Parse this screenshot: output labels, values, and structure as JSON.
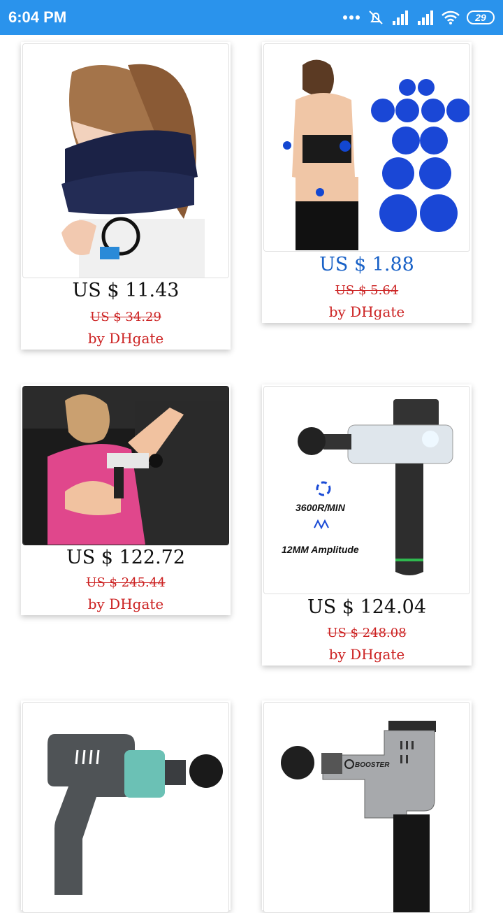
{
  "status": {
    "time": "6:04 PM",
    "battery": "29"
  },
  "products": [
    {
      "price": "US $ 11.43",
      "old_price": "US $ 34.29",
      "seller": "by DHgate"
    },
    {
      "price": "US $ 1.88",
      "old_price": "US $ 5.64",
      "seller": "by DHgate"
    },
    {
      "price": "US $ 122.72",
      "old_price": "US $ 245.44",
      "seller": "by DHgate"
    },
    {
      "price": "US $ 124.04",
      "old_price": "US $ 248.08",
      "seller": "by DHgate",
      "image_text": [
        "3600R/MIN",
        "12MM Amplitude"
      ]
    },
    {
      "image_text": []
    },
    {
      "image_text": [
        "BOOSTER"
      ]
    }
  ],
  "colors": {
    "status_bar": "#2a93ec",
    "strike_red": "#cc2222",
    "link_blue": "#1a62c7"
  }
}
